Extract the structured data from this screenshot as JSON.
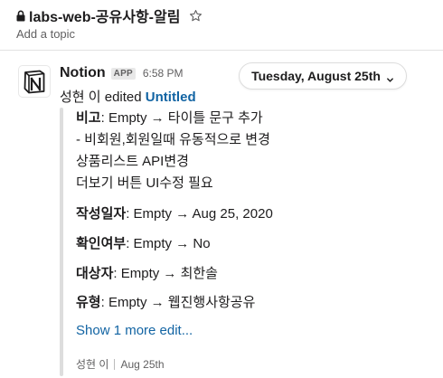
{
  "channel": {
    "name": "labs-web-공유사항-알림",
    "topic_placeholder": "Add a topic"
  },
  "message": {
    "sender": "Notion",
    "badge": "APP",
    "time": "6:58 PM",
    "date_divider": "Tuesday, August 25th",
    "edited_prefix": "성현 이 edited ",
    "page_title": "Untitled",
    "fields": [
      {
        "label": "비고",
        "value": ": Empty → 타이틀 문구 추가"
      },
      {
        "label": "",
        "value": "- 비회원,회원일때 유동적으로 변경"
      },
      {
        "label": "",
        "value": "상품리스트 API변경"
      },
      {
        "label": "",
        "value": "더보기 버튼 UI수정 필요"
      },
      {
        "label": "작성일자",
        "value": ": Empty → Aug 25, 2020"
      },
      {
        "label": "확인여부",
        "value": ": Empty → No"
      },
      {
        "label": "대상자",
        "value": ": Empty → 최한솔"
      },
      {
        "label": "유형",
        "value": ": Empty → 웹진행사항공유"
      }
    ],
    "show_more": "Show 1 more edit...",
    "footer_author": "성현 이",
    "footer_date": "Aug 25th"
  }
}
